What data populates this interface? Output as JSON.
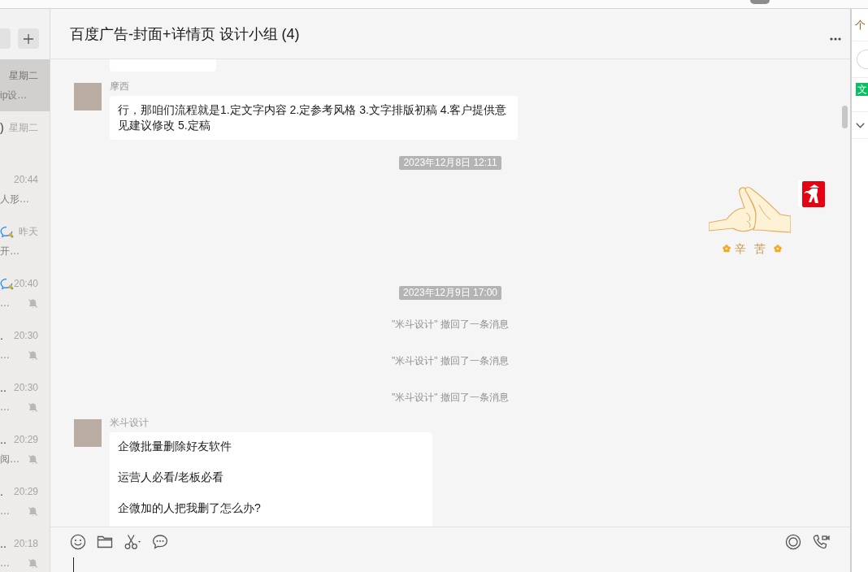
{
  "sidebar": {
    "conversations": [
      {
        "selected": true,
        "time": "星期二",
        "preview": "ip设…",
        "muted": false
      },
      {
        "selected": false,
        "name_tail": ")",
        "time": "星期二",
        "muted": false
      },
      {
        "selected": false,
        "time": "20:44",
        "preview": "人形…",
        "muted": false
      },
      {
        "selected": false,
        "badge": true,
        "time": "昨天",
        "preview": "开…",
        "muted": false
      },
      {
        "selected": false,
        "badge": true,
        "time": "20:40",
        "preview": "…",
        "muted": true
      },
      {
        "selected": false,
        "name_tail": ".",
        "time": "20:30",
        "preview": "…",
        "muted": true
      },
      {
        "selected": false,
        "name_tail": "..",
        "time": "20:30",
        "preview": "…",
        "muted": true
      },
      {
        "selected": false,
        "name_tail": "..",
        "time": "20:29",
        "preview": "阅…",
        "muted": true
      },
      {
        "selected": false,
        "name_tail": ".",
        "time": "20:29",
        "preview": "…",
        "muted": true
      },
      {
        "selected": false,
        "name_tail": "..",
        "time": "20:18",
        "preview": "…",
        "muted": true
      }
    ]
  },
  "chat": {
    "title": "百度广告-封面+详情页 设计小组 (4)",
    "messages": [
      {
        "kind": "fragment"
      },
      {
        "kind": "text",
        "sender": "摩西",
        "paragraphs": [
          "行，那咱们流程就是1.定文字内容 2.定参考风格 3.文字排版初稿 4.客户提供意见建议修改 5.定稿"
        ]
      },
      {
        "kind": "time",
        "text": "2023年12月8日 12:11"
      },
      {
        "kind": "sticker",
        "caption": "辛苦"
      },
      {
        "kind": "time",
        "text": "2023年12月9日 17:00"
      },
      {
        "kind": "notice",
        "text": "\"米斗设计\" 撤回了一条消息"
      },
      {
        "kind": "notice",
        "text": "\"米斗设计\" 撤回了一条消息"
      },
      {
        "kind": "notice",
        "text": "\"米斗设计\" 撤回了一条消息"
      },
      {
        "kind": "text",
        "sender": "米斗设计",
        "paragraphs": [
          "企微批量删除好友软件",
          "运营人必看/老板必看",
          "企微加的人把我删了怎么办?"
        ]
      }
    ]
  },
  "side_panel": {
    "label": "个",
    "button": "文"
  }
}
